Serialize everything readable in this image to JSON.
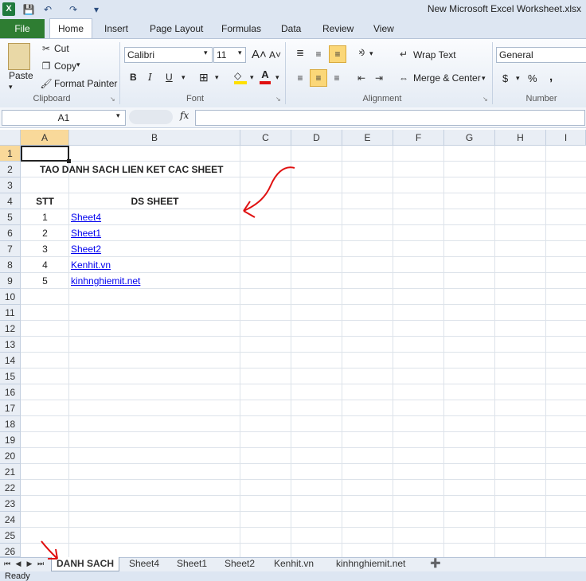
{
  "window": {
    "title": "New Microsoft Excel Worksheet.xlsx",
    "logo": "X"
  },
  "ribbon_tabs": [
    "File",
    "Home",
    "Insert",
    "Page Layout",
    "Formulas",
    "Data",
    "Review",
    "View"
  ],
  "clipboard": {
    "paste": "Paste",
    "cut": "Cut",
    "copy": "Copy",
    "format_painter": "Format Painter",
    "label": "Clipboard"
  },
  "font": {
    "name": "Calibri",
    "size": "11",
    "label": "Font"
  },
  "alignment": {
    "wrap_text": "Wrap Text",
    "merge_center": "Merge & Center",
    "label": "Alignment"
  },
  "number": {
    "format": "General",
    "currency": "$",
    "percent": "%",
    "comma": ",",
    "label": "Number"
  },
  "formula_bar": {
    "name_box": "A1",
    "fx": "fx",
    "value": ""
  },
  "columns": [
    "A",
    "B",
    "C",
    "D",
    "E",
    "F",
    "G",
    "H",
    "I"
  ],
  "rows": [
    "1",
    "2",
    "3",
    "4",
    "5",
    "6",
    "7",
    "8",
    "9",
    "10",
    "11",
    "12",
    "13",
    "14",
    "15",
    "16",
    "17",
    "18",
    "19",
    "20",
    "21",
    "22",
    "23",
    "24",
    "25",
    "26"
  ],
  "cells": {
    "title": "TAO DANH SACH LIEN KET CAC SHEET",
    "stt_header": "STT",
    "ds_header": "DS SHEET",
    "items": [
      {
        "stt": "1",
        "name": "Sheet4"
      },
      {
        "stt": "2",
        "name": "Sheet1"
      },
      {
        "stt": "3",
        "name": "Sheet2"
      },
      {
        "stt": "4",
        "name": "Kenhit.vn"
      },
      {
        "stt": "5",
        "name": "kinhnghiemit.net"
      }
    ]
  },
  "sheet_tabs": [
    "DANH SACH",
    "Sheet4",
    "Sheet1",
    "Sheet2",
    "Kenhit.vn",
    "kinhnghiemit.net"
  ],
  "status": "Ready",
  "colors": {
    "file_tab": "#2e7d32",
    "link": "#0000ee",
    "annotation": "#e01010"
  }
}
